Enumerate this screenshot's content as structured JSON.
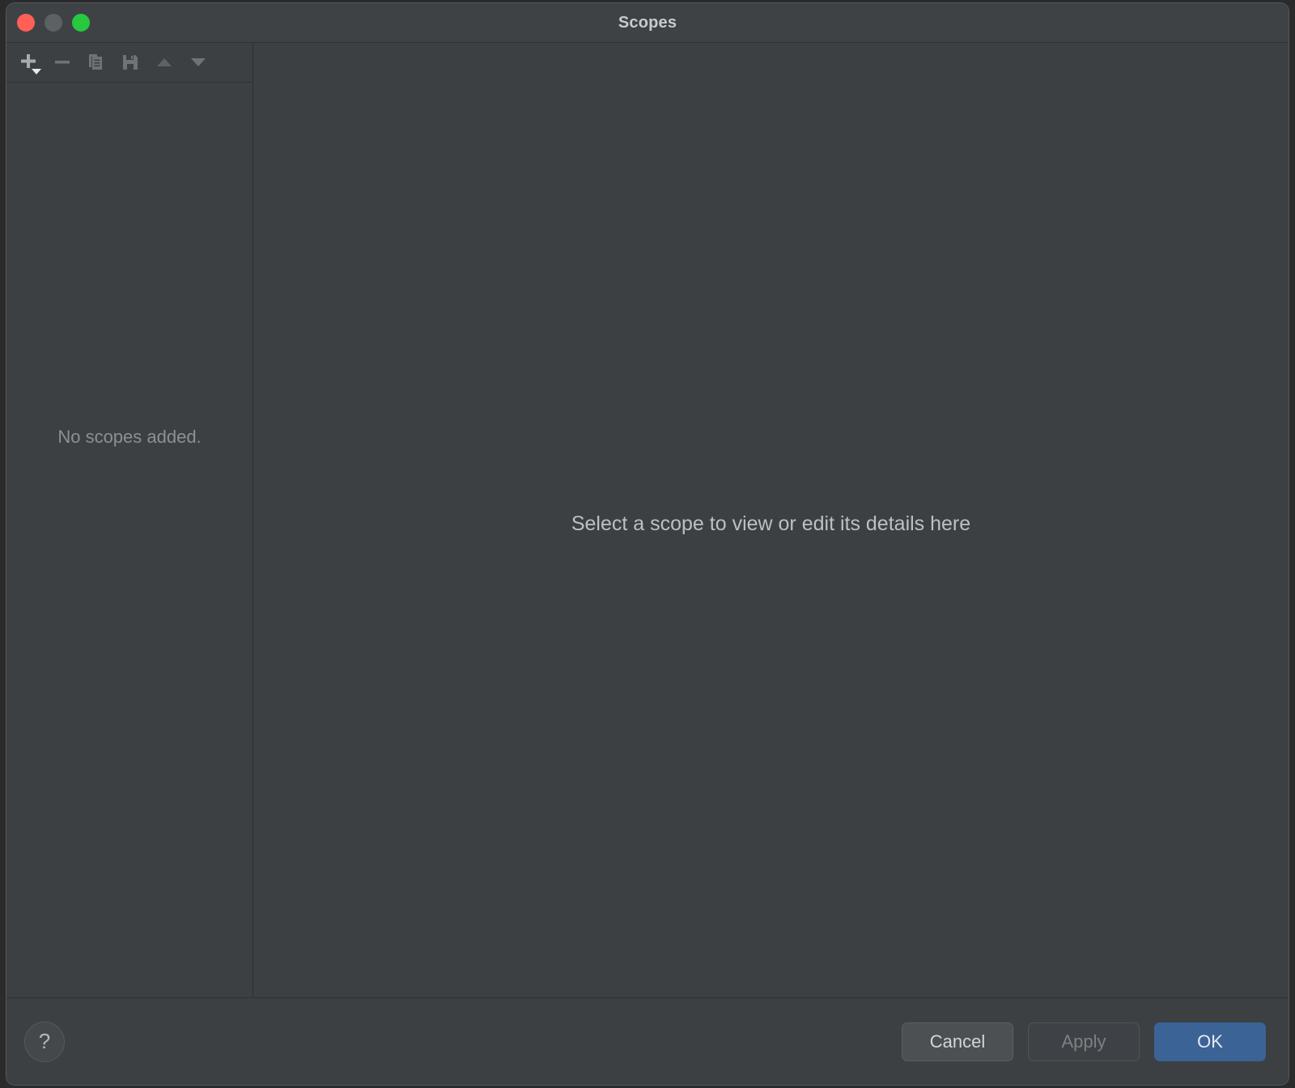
{
  "window": {
    "title": "Scopes",
    "traffic_lights": [
      {
        "name": "close",
        "color": "#ff5f57"
      },
      {
        "name": "minimize",
        "color": "#5d6164"
      },
      {
        "name": "zoom",
        "color": "#28c840"
      }
    ]
  },
  "toolbar": {
    "buttons": [
      {
        "icon": "add-icon",
        "label": "Add scope",
        "enabled": true,
        "has_dropdown": true
      },
      {
        "icon": "remove-icon",
        "label": "Remove scope",
        "enabled": false,
        "has_dropdown": false
      },
      {
        "icon": "copy-icon",
        "label": "Duplicate",
        "enabled": false,
        "has_dropdown": false
      },
      {
        "icon": "save-icon",
        "label": "Save",
        "enabled": false,
        "has_dropdown": false
      },
      {
        "icon": "move-up-icon",
        "label": "Move Up",
        "enabled": false,
        "has_dropdown": false
      },
      {
        "icon": "move-down-icon",
        "label": "Move Down",
        "enabled": false,
        "has_dropdown": false
      }
    ]
  },
  "scope_list": {
    "items": [],
    "empty_message": "No scopes added."
  },
  "detail_panel": {
    "placeholder": "Select a scope to view or edit its details here"
  },
  "footer": {
    "help_label": "?",
    "buttons": [
      {
        "name": "cancel",
        "label": "Cancel",
        "style": "secondary",
        "enabled": true
      },
      {
        "name": "apply",
        "label": "Apply",
        "style": "disabled",
        "enabled": false
      },
      {
        "name": "ok",
        "label": "OK",
        "style": "primary",
        "enabled": true
      }
    ]
  },
  "colors": {
    "window_background": "#3c4043",
    "titlebar_background": "#3f4245",
    "divider": "#2f3133",
    "primary_button": "#3b6396",
    "secondary_button": "#4c5053",
    "text_primary": "#c8cacc",
    "text_muted": "#8c9092"
  }
}
